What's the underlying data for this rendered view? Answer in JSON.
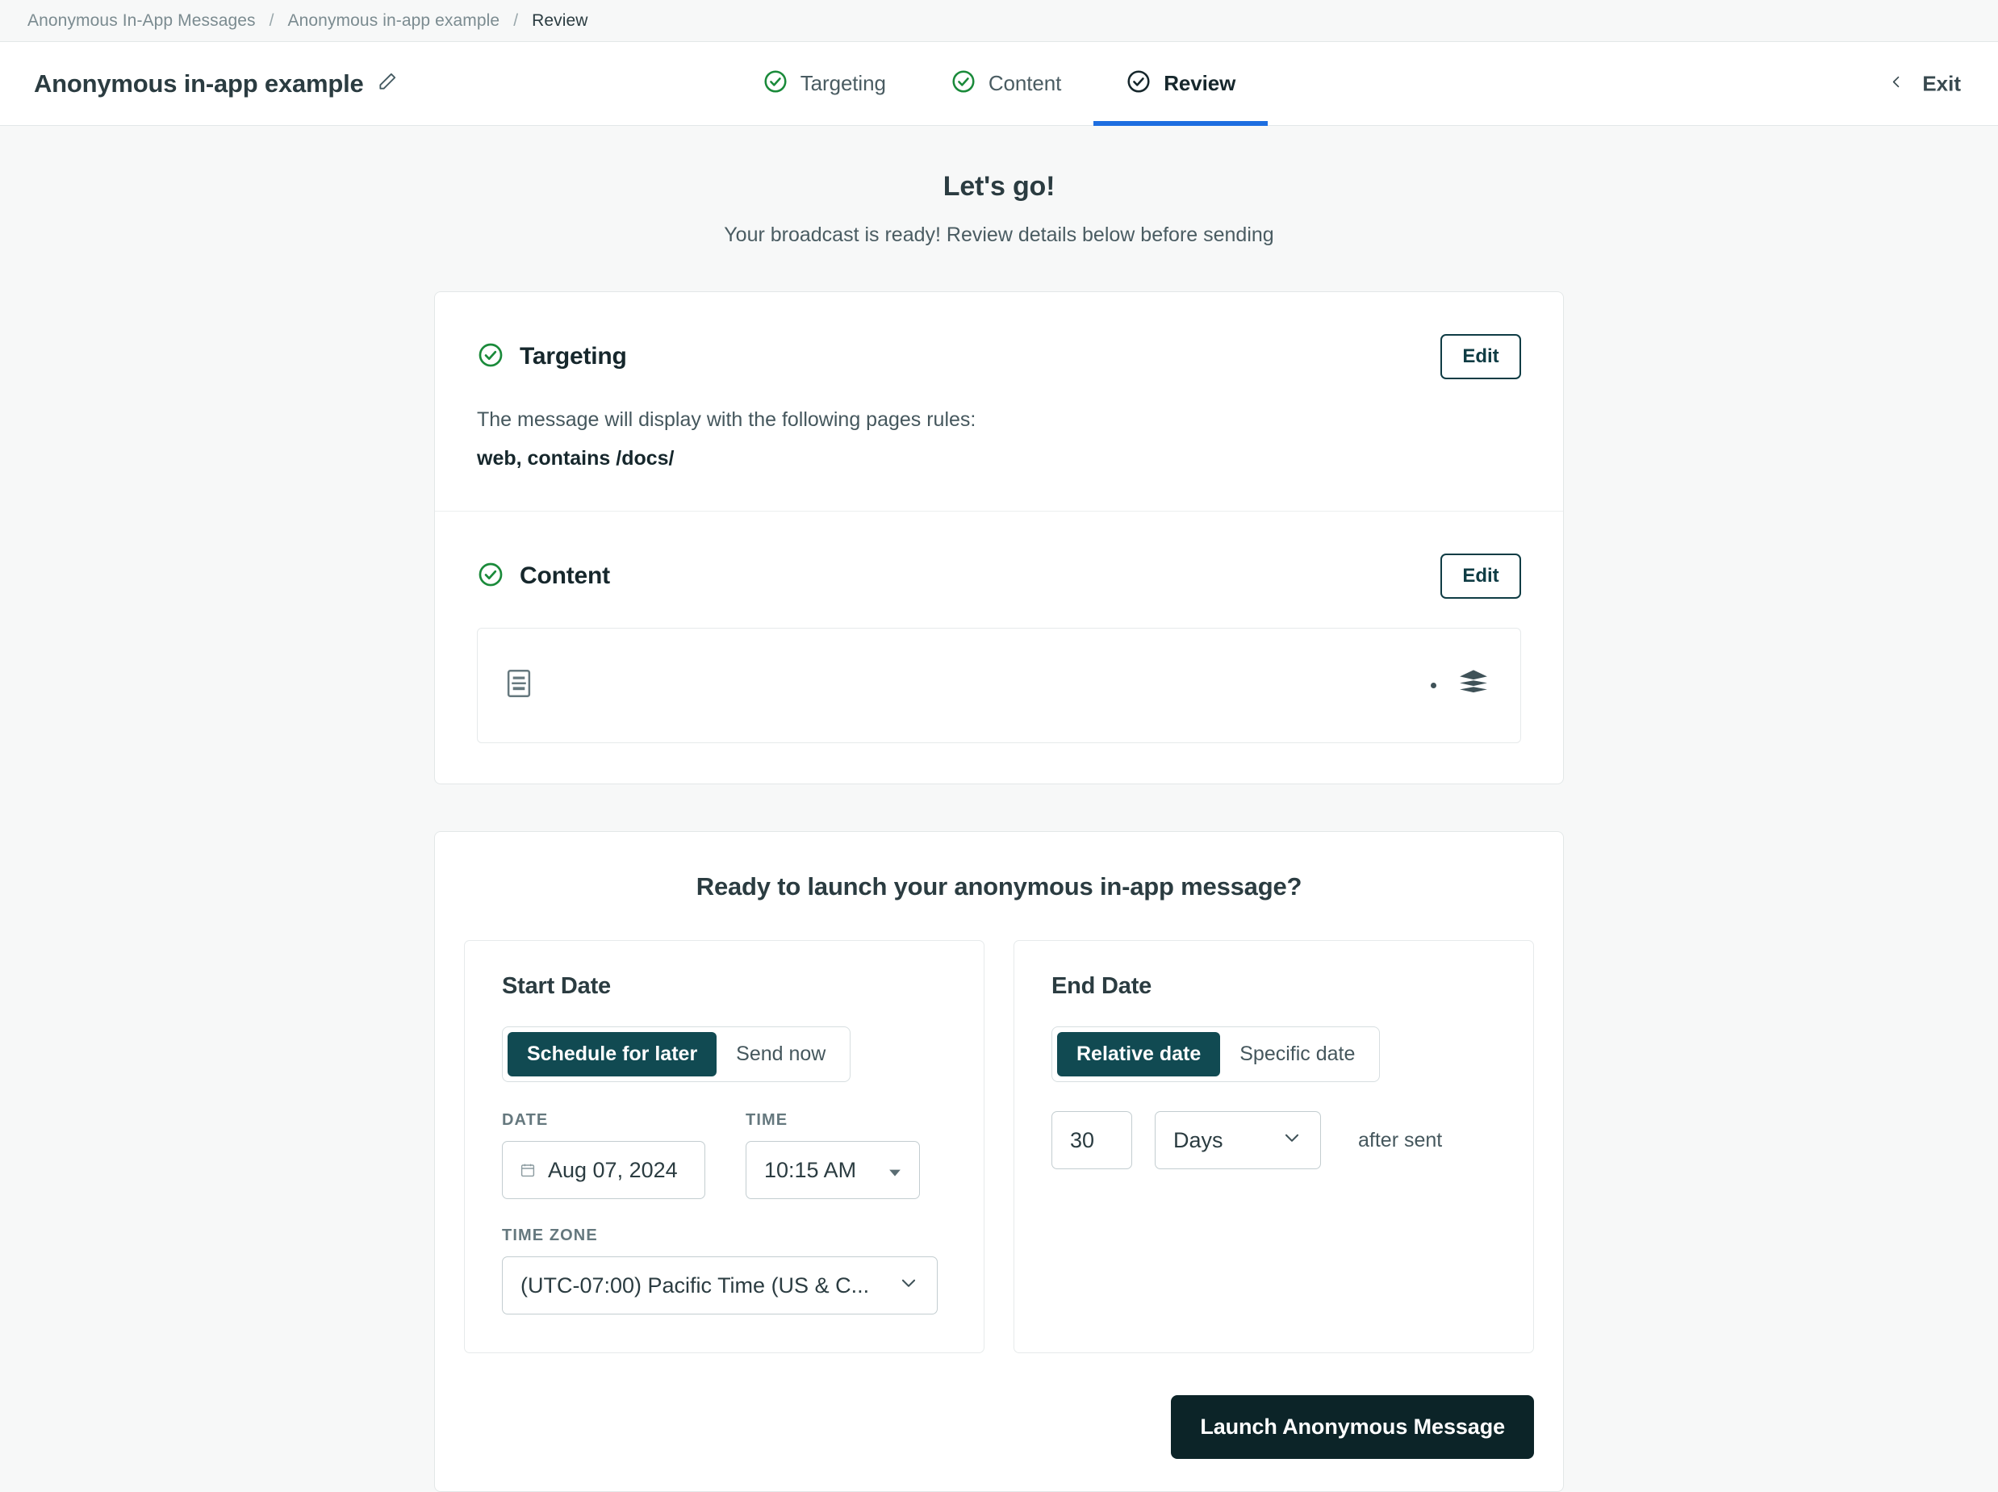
{
  "breadcrumb": {
    "items": [
      "Anonymous In-App Messages",
      "Anonymous in-app example",
      "Review"
    ],
    "separator": "/"
  },
  "header": {
    "title": "Anonymous in-app example",
    "edit_title_icon": "pencil-icon",
    "steps": [
      {
        "label": "Targeting",
        "state": "complete",
        "icon": "check-circle-icon"
      },
      {
        "label": "Content",
        "state": "complete",
        "icon": "check-circle-icon"
      },
      {
        "label": "Review",
        "state": "active",
        "icon": "check-circle-icon"
      }
    ],
    "exit_label": "Exit",
    "exit_icon": "chevron-left-icon"
  },
  "hero": {
    "title": "Let's go!",
    "subtitle": "Your broadcast is ready! Review details below before sending"
  },
  "summary": {
    "targeting": {
      "title": "Targeting",
      "icon": "check-circle-icon",
      "edit_label": "Edit",
      "description": "The message will display with the following pages rules:",
      "rule": "web, contains /docs/"
    },
    "content": {
      "title": "Content",
      "icon": "check-circle-icon",
      "edit_label": "Edit",
      "preview_left_icon": "document-layout-icon",
      "preview_right_icon": "layers-icon"
    }
  },
  "launch": {
    "title": "Ready to launch your anonymous in-app message?",
    "start_date": {
      "panel_title": "Start Date",
      "toggle": {
        "options": [
          "Schedule for later",
          "Send now"
        ],
        "selected": "Schedule for later"
      },
      "date_label": "DATE",
      "date_value": "Aug 07, 2024",
      "date_icon": "calendar-icon",
      "time_label": "TIME",
      "time_value": "10:15 AM",
      "time_icon": "caret-down-icon",
      "timezone_label": "TIME ZONE",
      "timezone_value": "(UTC-07:00) Pacific Time (US & C...",
      "timezone_icon": "chevron-down-icon"
    },
    "end_date": {
      "panel_title": "End Date",
      "toggle": {
        "options": [
          "Relative date",
          "Specific date"
        ],
        "selected": "Relative date"
      },
      "amount_value": "30",
      "unit_value": "Days",
      "unit_icon": "chevron-down-icon",
      "suffix_text": "after sent"
    },
    "launch_button_label": "Launch Anonymous Message"
  },
  "colors": {
    "page_bg": "#f7f8f8",
    "accent_blue": "#1d6ee0",
    "check_green": "#1a8a3a",
    "toggle_selected": "#114a52",
    "primary_dark": "#0c2428",
    "border": "#e3e7e8"
  }
}
